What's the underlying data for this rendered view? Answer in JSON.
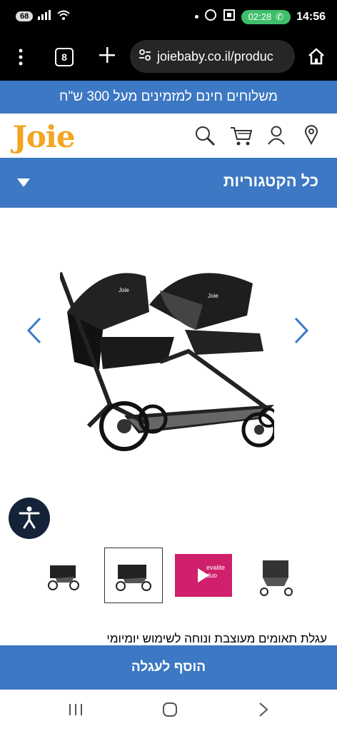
{
  "status_bar": {
    "battery": "68",
    "call_time": "02:28",
    "clock": "14:56"
  },
  "browser": {
    "tab_count": "8",
    "url": "joiebaby.co.il/produc"
  },
  "promo": {
    "text": "משלוחים חינם למזמינים מעל 300 ש\"ח"
  },
  "header": {
    "logo": "Joie",
    "icons": [
      "search-icon",
      "cart-icon",
      "account-icon",
      "location-icon"
    ]
  },
  "categories": {
    "label": "כל הקטגוריות"
  },
  "product": {
    "image_alt": "double stroller",
    "thumb_video_label": "evalite duo"
  },
  "description": {
    "clipped_text": "עגלת תאומים מעוצבת ונוחה לשימוש יומיומי"
  },
  "cta": {
    "add_to_cart": "הוסף לעגלה"
  },
  "colors": {
    "brand_blue": "#3c78c3",
    "logo_orange": "#f3a421",
    "access_navy": "#142338"
  }
}
